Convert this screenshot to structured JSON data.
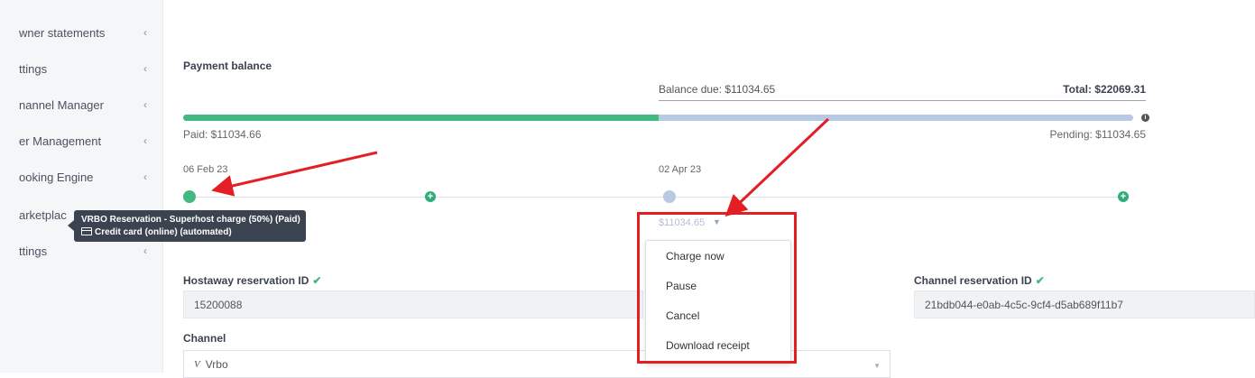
{
  "sidebar": {
    "items": [
      {
        "label": "wner statements",
        "chevron": "‹"
      },
      {
        "label": "ttings",
        "chevron": "‹"
      },
      {
        "label": "nannel Manager",
        "chevron": "‹"
      },
      {
        "label": "er Management",
        "chevron": "‹"
      },
      {
        "label": "ooking Engine",
        "chevron": "‹"
      },
      {
        "label": "arketplac",
        "chevron": ""
      },
      {
        "label": "ttings",
        "chevron": "‹"
      }
    ]
  },
  "payment": {
    "title": "Payment balance",
    "balance_due": "Balance due: $11034.65",
    "total": "Total: $22069.31",
    "paid": "Paid: $11034.66",
    "pending": "Pending: $11034.65",
    "paid_fraction": 0.5
  },
  "timeline": {
    "date1": "06 Feb 23",
    "date2": "02 Apr 23",
    "amount": "$11034.65"
  },
  "tooltip": {
    "line1": "VRBO Reservation - Superhost charge (50%) (Paid)",
    "line2": "Credit card (online) (automated)"
  },
  "dropdown": {
    "items": [
      "Charge now",
      "Pause",
      "Cancel",
      "Download receipt"
    ]
  },
  "form": {
    "hostaway_label": "Hostaway reservation ID",
    "hostaway_value": "15200088",
    "channel_res_label": "Channel reservation ID",
    "channel_res_value": "21bdb044-e0ab-4c5c-9cf4-d5ab689f11b7",
    "channel_label": "Channel",
    "channel_value": "Vrbo"
  },
  "colors": {
    "paid_green": "#42b883",
    "pending_blue": "#b8c9e4",
    "annotation_red": "#e31e24"
  }
}
